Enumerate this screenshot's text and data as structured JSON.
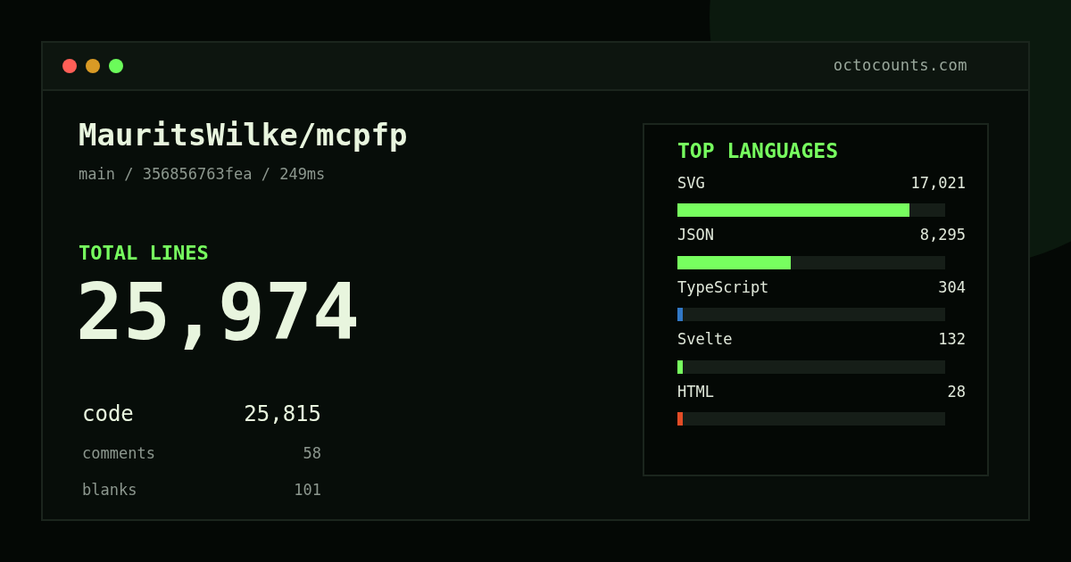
{
  "window": {
    "dots": [
      {
        "color": "#ff5f57"
      },
      {
        "color": "#d99a25"
      },
      {
        "color": "#6bfb5a"
      }
    ],
    "domain": "octocounts.com"
  },
  "repo": {
    "title": "MauritsWilke/mcpfp",
    "meta": "main / 356856763fea / 249ms"
  },
  "total": {
    "label": "TOTAL LINES",
    "value": "25,974"
  },
  "breakdown": [
    {
      "kind": "main",
      "label": "code",
      "value": "25,815"
    },
    {
      "kind": "minor",
      "label": "comments",
      "value": "58"
    },
    {
      "kind": "minor",
      "label": "blanks",
      "value": "101"
    }
  ],
  "languages": {
    "title": "TOP LANGUAGES",
    "items": [
      {
        "name": "SVG",
        "value": "17,021",
        "level": 0.867,
        "color": "#77ff5f"
      },
      {
        "name": "JSON",
        "value": "8,295",
        "level": 0.423,
        "color": "#77ff5f"
      },
      {
        "name": "TypeScript",
        "value": "304",
        "level": 0.02,
        "color": "#3178c6"
      },
      {
        "name": "Svelte",
        "value": "132",
        "level": 0.02,
        "color": "#77ff5f"
      },
      {
        "name": "HTML",
        "value": "28",
        "level": 0.02,
        "color": "#e34c26"
      }
    ]
  }
}
